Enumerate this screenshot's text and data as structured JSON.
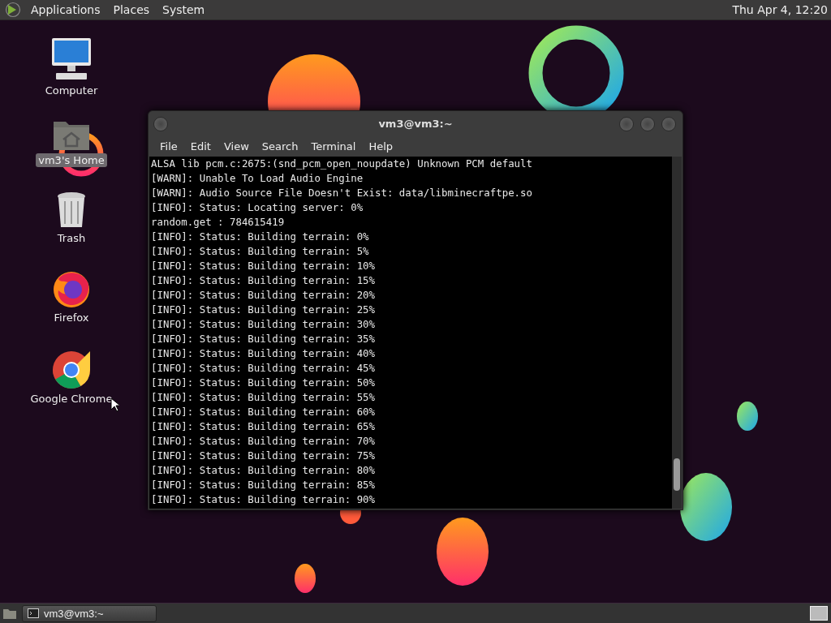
{
  "top_panel": {
    "menus": [
      "Applications",
      "Places",
      "System"
    ],
    "clock": "Thu Apr  4, 12:20"
  },
  "desktop_icons": [
    {
      "kind": "computer",
      "label": "Computer",
      "selected": false
    },
    {
      "kind": "home",
      "label": "vm3's Home",
      "selected": true
    },
    {
      "kind": "trash",
      "label": "Trash",
      "selected": false
    },
    {
      "kind": "firefox",
      "label": "Firefox",
      "selected": false
    },
    {
      "kind": "chrome",
      "label": "Google Chrome",
      "selected": false
    }
  ],
  "terminal": {
    "title": "vm3@vm3:~",
    "menu": [
      "File",
      "Edit",
      "View",
      "Search",
      "Terminal",
      "Help"
    ],
    "lines": [
      "ALSA lib pcm.c:2675:(snd_pcm_open_noupdate) Unknown PCM default",
      "[WARN]: Unable To Load Audio Engine",
      "[WARN]: Audio Source File Doesn't Exist: data/libminecraftpe.so",
      "[INFO]: Status: Locating server: 0%",
      "random.get : 784615419",
      "[INFO]: Status: Building terrain: 0%",
      "[INFO]: Status: Building terrain: 5%",
      "[INFO]: Status: Building terrain: 10%",
      "[INFO]: Status: Building terrain: 15%",
      "[INFO]: Status: Building terrain: 20%",
      "[INFO]: Status: Building terrain: 25%",
      "[INFO]: Status: Building terrain: 30%",
      "[INFO]: Status: Building terrain: 35%",
      "[INFO]: Status: Building terrain: 40%",
      "[INFO]: Status: Building terrain: 45%",
      "[INFO]: Status: Building terrain: 50%",
      "[INFO]: Status: Building terrain: 55%",
      "[INFO]: Status: Building terrain: 60%",
      "[INFO]: Status: Building terrain: 65%",
      "[INFO]: Status: Building terrain: 70%",
      "[INFO]: Status: Building terrain: 75%",
      "[INFO]: Status: Building terrain: 80%",
      "[INFO]: Status: Building terrain: 85%",
      "[INFO]: Status: Building terrain: 90%"
    ]
  },
  "taskbar": {
    "windows": [
      {
        "label": "vm3@vm3:~",
        "selected": false
      }
    ]
  }
}
